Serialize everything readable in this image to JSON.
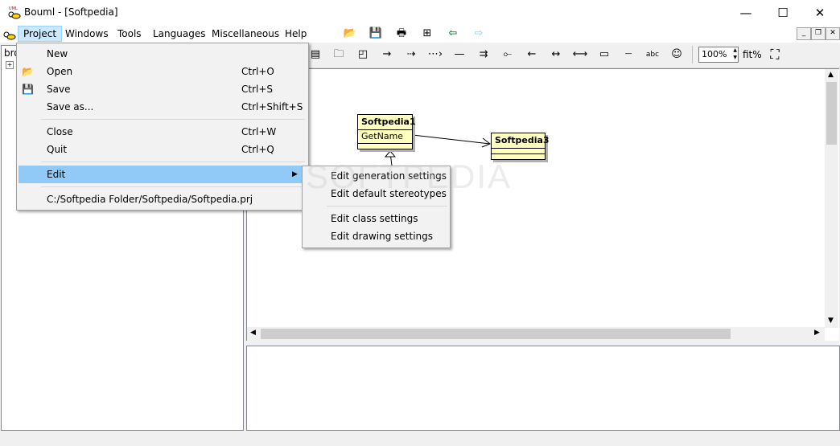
{
  "window": {
    "title": "Bouml - [Softpedia]"
  },
  "menubar": [
    "Project",
    "Windows",
    "Tools",
    "Languages",
    "Miscellaneous",
    "Help"
  ],
  "toolbar": {
    "zoom": "100%",
    "fit_label": "fit%"
  },
  "browser": {
    "root_label": "bro"
  },
  "diagram": {
    "classes": [
      {
        "name": "Softpedia1",
        "operations": [
          "GetName"
        ]
      },
      {
        "name": "Softpedia3",
        "operations": []
      }
    ]
  },
  "project_menu": {
    "items": [
      {
        "label": "New",
        "shortcut": "",
        "icon": "new-icon"
      },
      {
        "label": "Open",
        "shortcut": "Ctrl+O",
        "icon": "folder-open-icon"
      },
      {
        "label": "Save",
        "shortcut": "Ctrl+S",
        "icon": "save-icon"
      },
      {
        "label": "Save as...",
        "shortcut": "Ctrl+Shift+S",
        "icon": ""
      },
      {
        "label": "Close",
        "shortcut": "Ctrl+W",
        "icon": ""
      },
      {
        "label": "Quit",
        "shortcut": "Ctrl+Q",
        "icon": ""
      },
      {
        "label": "Edit",
        "shortcut": "",
        "icon": ""
      },
      {
        "label": "C:/Softpedia Folder/Softpedia/Softpedia.prj",
        "shortcut": "",
        "icon": ""
      }
    ]
  },
  "edit_submenu": {
    "items": [
      "Edit generation settings",
      "Edit default stereotypes",
      "Edit class settings",
      "Edit drawing settings"
    ]
  },
  "watermark": "SOFTPEDIA",
  "colors": {
    "highlight": "#91c9f7",
    "menu_active": "#cce8ff",
    "class_fill": "#ffffc0"
  }
}
